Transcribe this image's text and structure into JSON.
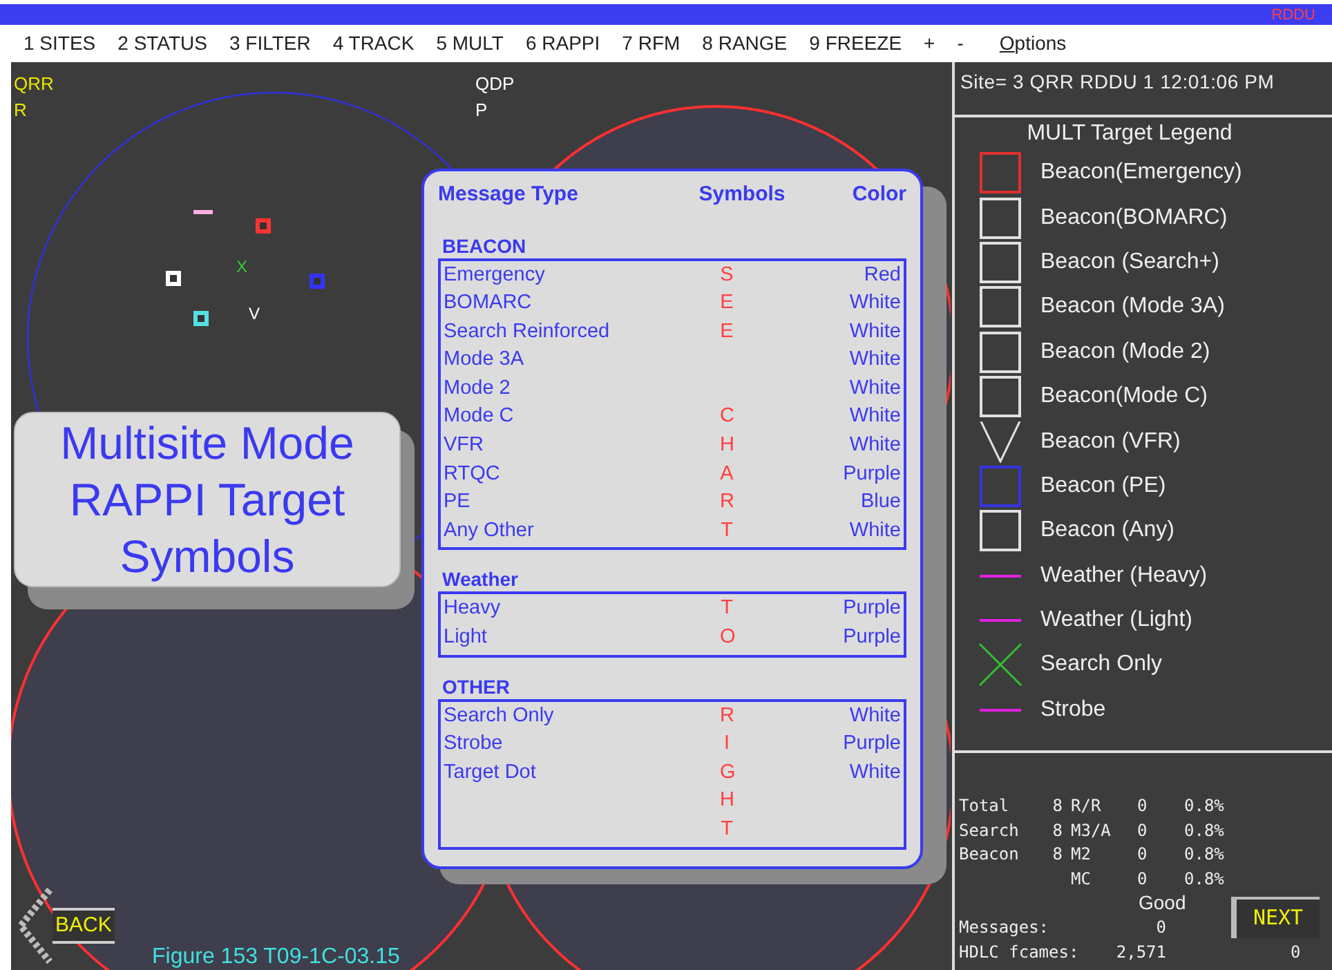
{
  "top_bar": {
    "text": "RDDU"
  },
  "menu": [
    {
      "label": "1 SITES",
      "mnemonic": false
    },
    {
      "label": "2 STATUS",
      "mnemonic": false
    },
    {
      "label": "3 FILTER",
      "mnemonic": false
    },
    {
      "label": "4 TRACK",
      "mnemonic": false
    },
    {
      "label": "5 MULT",
      "mnemonic": false
    },
    {
      "label": "6 RAPPI",
      "mnemonic": false
    },
    {
      "label": "7 RFM",
      "mnemonic": false
    },
    {
      "label": "8 RANGE",
      "mnemonic": false
    },
    {
      "label": "9 FREEZE",
      "mnemonic": false
    },
    {
      "label": "+",
      "mnemonic": false
    },
    {
      "label": "-",
      "mnemonic": false
    },
    {
      "label": "Options",
      "mnemonic": true
    }
  ],
  "site_labels": [
    {
      "lines": [
        "QRR",
        "R"
      ],
      "color": "#e8e800"
    },
    {
      "lines": [
        "QDP",
        "P"
      ],
      "color": "#ffffff"
    }
  ],
  "targets": [
    {
      "kind": "line",
      "color": "#ffb0e0"
    },
    {
      "kind": "square",
      "color": "#ff3333"
    },
    {
      "kind": "glyph",
      "text": "X",
      "color": "#33cc33"
    },
    {
      "kind": "square",
      "color": "#ffffff"
    },
    {
      "kind": "square",
      "color": "#3333ff"
    },
    {
      "kind": "square",
      "color": "#55e0e0"
    },
    {
      "kind": "glyph",
      "text": "V",
      "color": "#ffffff"
    }
  ],
  "title_card": {
    "lines": [
      "Multisite Mode",
      "RAPPI Target",
      "Symbols"
    ]
  },
  "symbol_table": {
    "columns": [
      "Message Type",
      "Symbols",
      "Color"
    ],
    "sections": [
      {
        "title": "BEACON",
        "rows": [
          {
            "type": "Emergency",
            "symbol": "S",
            "color_name": "Red"
          },
          {
            "type": "BOMARC",
            "symbol": "E",
            "color_name": "White"
          },
          {
            "type": "Search Reinforced",
            "symbol": "E",
            "color_name": "White"
          },
          {
            "type": "Mode 3A",
            "color_name": "White"
          },
          {
            "type": "Mode 2",
            "color_name": "White"
          },
          {
            "type": "Mode C",
            "symbol": "C",
            "color_name": "White"
          },
          {
            "type": "VFR",
            "symbol": "H",
            "color_name": "White"
          },
          {
            "type": "RTQC",
            "symbol": "A",
            "color_name": "Purple"
          },
          {
            "type": "PE",
            "symbol": "R",
            "color_name": "Blue"
          },
          {
            "type": "Any Other",
            "symbol": "T",
            "color_name": "White"
          }
        ]
      },
      {
        "title": "Weather",
        "rows": [
          {
            "type": "Heavy",
            "symbol": "T",
            "color_name": "Purple"
          },
          {
            "type": "Light",
            "symbol": "O",
            "color_name": "Purple"
          }
        ]
      },
      {
        "title": "OTHER",
        "rows": [
          {
            "type": "Search Only",
            "symbol": "R",
            "color_name": "White"
          },
          {
            "type": "Strobe",
            "symbol": "I",
            "color_name": "Purple"
          },
          {
            "type": "Target Dot",
            "symbol": "G",
            "color_name": "White"
          },
          {
            "symbol": "H"
          },
          {
            "symbol": "T"
          }
        ]
      }
    ]
  },
  "back_button": {
    "label": "BACK"
  },
  "caption": "Figure 153 T09-1C-03.15",
  "site_line": "Site= 3 QRR  RDDU 1 12:01:06 PM",
  "legend": {
    "title": "MULT Target Legend",
    "items": [
      {
        "kind": "square",
        "color": "#e03030",
        "label": "Beacon(Emergency)"
      },
      {
        "kind": "square",
        "color": "#e0e0e0",
        "label": "Beacon(BOMARC)"
      },
      {
        "kind": "square",
        "color": "#e0e0e0",
        "label": "Beacon (Search+)"
      },
      {
        "kind": "square",
        "color": "#e0e0e0",
        "label": "Beacon (Mode 3A)"
      },
      {
        "kind": "square",
        "color": "#e0e0e0",
        "label": "Beacon (Mode 2)"
      },
      {
        "kind": "square",
        "color": "#e0e0e0",
        "label": "Beacon(Mode C)"
      },
      {
        "kind": "vee",
        "color": "#e0e0e0",
        "label": "Beacon (VFR)"
      },
      {
        "kind": "square",
        "color": "#3333e0",
        "label": "Beacon (PE)"
      },
      {
        "kind": "square",
        "color": "#e0e0e0",
        "label": "Beacon (Any)"
      },
      {
        "kind": "line",
        "color": "#e020e0",
        "label": "Weather (Heavy)"
      },
      {
        "kind": "line",
        "color": "#e020e0",
        "label": "Weather (Light)"
      },
      {
        "kind": "cross",
        "color": "#30c030",
        "label": "Search Only"
      },
      {
        "kind": "line",
        "color": "#e020e0",
        "label": "Strobe"
      }
    ]
  },
  "stats": {
    "rows": [
      {
        "label": "Total",
        "count": "8",
        "code": "R/R",
        "zero": "0",
        "percent": "0.8%"
      },
      {
        "label": "Search",
        "count": "8",
        "code": "M3/A",
        "zero": "0",
        "percent": "0.8%"
      },
      {
        "label": "Beacon",
        "count": "8",
        "code": "M2",
        "zero": "0",
        "percent": "0.8%"
      },
      {
        "code": "MC",
        "zero": "0",
        "percent": "0.8%"
      }
    ],
    "status": "Good",
    "counters": [
      {
        "label": "Messages:",
        "value": "0"
      },
      {
        "label": "HDLC fcames:",
        "value": "2,571",
        "extra": "0"
      }
    ]
  },
  "next_button": {
    "label": "NEXT"
  }
}
